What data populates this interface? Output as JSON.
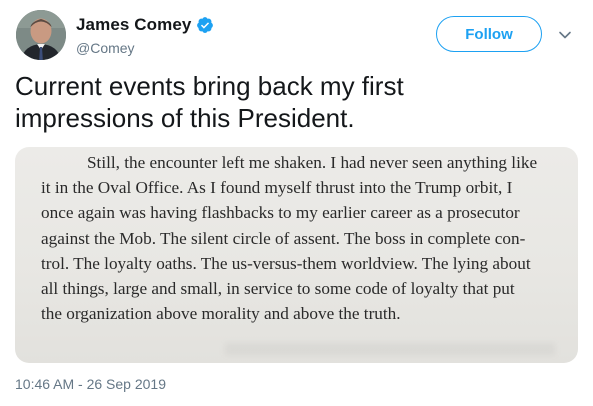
{
  "author": {
    "display_name": "James Comey",
    "handle": "@Comey",
    "verified": true
  },
  "actions": {
    "follow_label": "Follow"
  },
  "tweet": {
    "text": "Current events bring back my first\nimpressions of this President.",
    "timestamp": "10:46 AM - 26 Sep 2019"
  },
  "media": {
    "lines": [
      "Still, the encounter left me shaken. I had never seen anything like",
      "it in the Oval Office. As I found myself thrust into the Trump orbit, I",
      "once again was having flashbacks to my earlier career as a prosecutor",
      "against the Mob. The silent circle of assent. The boss in complete con-",
      "trol. The loyalty oaths. The us-versus-them worldview. The lying about",
      "all things, large and small, in service to some code of loyalty that put",
      "the organization above morality and above the truth."
    ]
  },
  "icons": {
    "verified": "verified-badge-icon",
    "more": "chevron-down-icon"
  },
  "colors": {
    "accent": "#1da1f2",
    "secondary_text": "#657786",
    "primary_text": "#14171a"
  }
}
